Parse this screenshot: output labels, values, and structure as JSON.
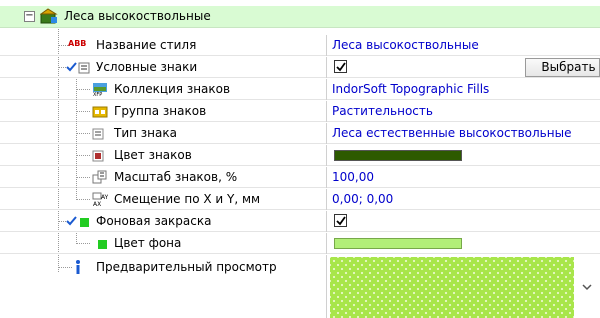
{
  "root": {
    "toggle": "−",
    "label": "Леса высокоствольные"
  },
  "rows": {
    "style_name": {
      "label": "Название стиля",
      "value": "Леса высокоствольные",
      "icon_text": "ABB"
    },
    "symbols": {
      "label": "Условные знаки",
      "checked": true,
      "button": "Выбрать"
    },
    "collection": {
      "label": "Коллекция знаков",
      "value": "IndorSoft Topographic Fills"
    },
    "group": {
      "label": "Группа знаков",
      "value": "Растительность"
    },
    "type": {
      "label": "Тип знака",
      "value": "Леса естественные высокоствольные"
    },
    "color": {
      "label": "Цвет знаков",
      "swatch_color": "#2d5a00"
    },
    "scale": {
      "label": "Масштаб знаков, %",
      "value": "100,00"
    },
    "offset": {
      "label": "Смещение по X и Y, мм",
      "value": "0,00; 0,00"
    },
    "fill": {
      "label": "Фоновая закраска",
      "checked": true
    },
    "fill_color": {
      "label": "Цвет фона",
      "swatch_color": "#b2ef78"
    },
    "preview": {
      "label": "Предварительный просмотр"
    }
  },
  "icons": [
    "collapse-icon",
    "folder-style-icon",
    "abb-text-icon",
    "checkmark-icon",
    "symbol-list-icon",
    "collection-icon",
    "group-icon",
    "type-icon",
    "color-icon",
    "scale-icon",
    "offset-icon",
    "fill-icon",
    "preview-icon",
    "chevron-down-icon"
  ]
}
